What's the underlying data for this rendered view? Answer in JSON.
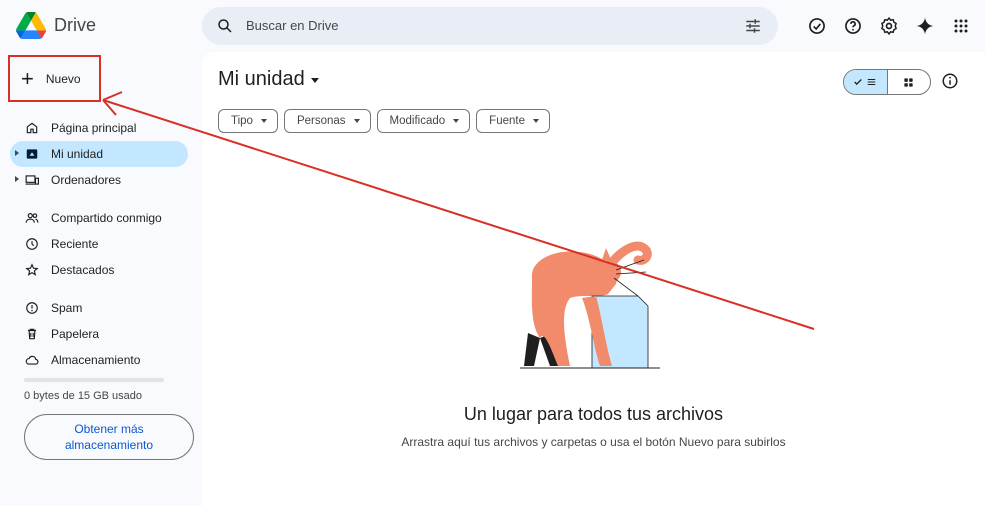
{
  "app": {
    "name": "Drive"
  },
  "search": {
    "placeholder": "Buscar en Drive"
  },
  "new_button": {
    "label": "Nuevo"
  },
  "sidebar": {
    "items": [
      {
        "label": "Página principal",
        "icon": "home-icon"
      },
      {
        "label": "Mi unidad",
        "icon": "my-drive-icon",
        "active": true
      },
      {
        "label": "Ordenadores",
        "icon": "computers-icon"
      },
      {
        "label": "Compartido conmigo",
        "icon": "shared-icon"
      },
      {
        "label": "Reciente",
        "icon": "clock-icon"
      },
      {
        "label": "Destacados",
        "icon": "star-icon"
      },
      {
        "label": "Spam",
        "icon": "spam-icon"
      },
      {
        "label": "Papelera",
        "icon": "trash-icon"
      },
      {
        "label": "Almacenamiento",
        "icon": "cloud-icon"
      }
    ]
  },
  "storage": {
    "usage_text": "0 bytes de 15 GB usado",
    "get_more_label": "Obtener más almacenamiento"
  },
  "main": {
    "title": "Mi unidad",
    "filters": [
      "Tipo",
      "Personas",
      "Modificado",
      "Fuente"
    ],
    "empty_title": "Un lugar para todos tus archivos",
    "empty_subtitle": "Arrastra aquí tus archivos y carpetas o usa el botón Nuevo para subirlos"
  },
  "colors": {
    "accent": "#0b57d0",
    "active_bg": "#c2e7ff",
    "annotation": "#d93025"
  }
}
